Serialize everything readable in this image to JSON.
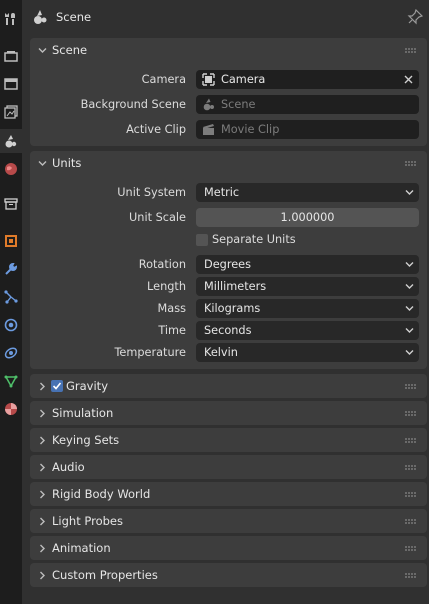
{
  "header": {
    "title": "Scene"
  },
  "tabs": [
    {
      "name": "tool-icon"
    },
    {
      "name": "render-icon"
    },
    {
      "name": "output-icon"
    },
    {
      "name": "view-layer-icon"
    },
    {
      "name": "scene-icon",
      "active": true
    },
    {
      "name": "world-icon"
    },
    {
      "name": "collection-icon"
    },
    {
      "name": "object-icon"
    },
    {
      "name": "modifier-icon"
    },
    {
      "name": "particles-icon"
    },
    {
      "name": "physics-icon"
    },
    {
      "name": "constraints-icon"
    },
    {
      "name": "data-icon"
    },
    {
      "name": "material-icon"
    }
  ],
  "scene_panel": {
    "title": "Scene",
    "camera_label": "Camera",
    "camera_value": "Camera",
    "background_label": "Background Scene",
    "background_placeholder": "Scene",
    "clip_label": "Active Clip",
    "clip_placeholder": "Movie Clip"
  },
  "units_panel": {
    "title": "Units",
    "unit_system_label": "Unit System",
    "unit_system_value": "Metric",
    "unit_scale_label": "Unit Scale",
    "unit_scale_value": "1.000000",
    "separate_units_label": "Separate Units",
    "separate_units_checked": false,
    "rotation_label": "Rotation",
    "rotation_value": "Degrees",
    "length_label": "Length",
    "length_value": "Millimeters",
    "mass_label": "Mass",
    "mass_value": "Kilograms",
    "time_label": "Time",
    "time_value": "Seconds",
    "temperature_label": "Temperature",
    "temperature_value": "Kelvin"
  },
  "collapsed_panels": {
    "gravity": {
      "title": "Gravity",
      "checked": true
    },
    "simulation": "Simulation",
    "keying_sets": "Keying Sets",
    "audio": "Audio",
    "rigid_body_world": "Rigid Body World",
    "light_probes": "Light Probes",
    "animation": "Animation",
    "custom_properties": "Custom Properties"
  },
  "colors": {
    "background": "#303030",
    "panel": "#3d3d3d",
    "field_dark": "#1f1f1f",
    "accent_blue": "#4772b3"
  }
}
